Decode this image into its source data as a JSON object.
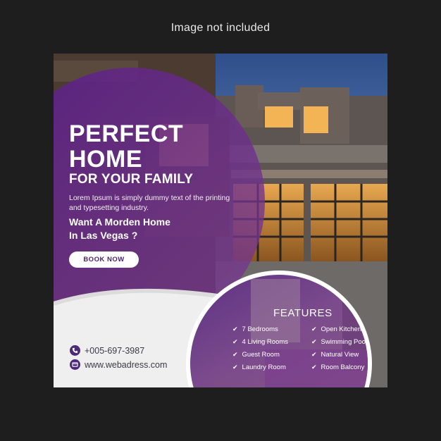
{
  "notice": "Image not included",
  "poster": {
    "headline_line1": "PERFECT",
    "headline_line2": "HOME",
    "subheadline": "FOR YOUR FAMILY",
    "description": "Lorem Ipsum is simply dummy text of the printing and typesetting industry.",
    "question_line1": "Want A Morden Home",
    "question_line2": "In Las Vegas ?",
    "cta_label": "BOOK NOW",
    "phone": "+005-697-3987",
    "website": "www.webadress.com",
    "features_title": "FEATURES",
    "features_left": [
      "7  Bedrooms",
      "4 Living Rooms",
      "Guest Room",
      "Laundry Room"
    ],
    "features_right": [
      "Open Kitchen",
      "Swimming Pool",
      "Natural View",
      "Room Balcony"
    ],
    "icons": {
      "phone": "phone-icon",
      "web": "globe-icon",
      "check": "check-icon"
    },
    "colors": {
      "purple": "#5b2d86",
      "purple_dark": "#3a1a5c",
      "white": "#ffffff",
      "grey": "#efefef"
    }
  }
}
